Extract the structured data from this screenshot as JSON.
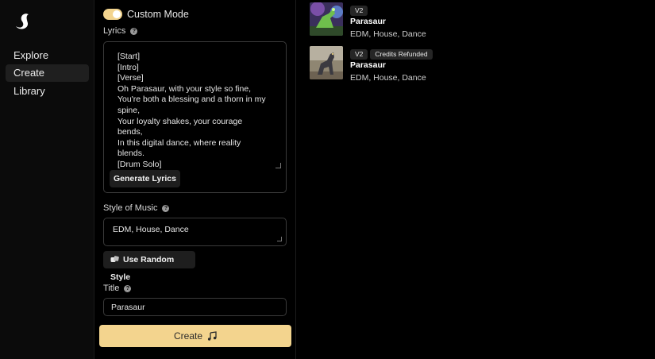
{
  "sidebar": {
    "items": [
      {
        "label": "Explore",
        "active": false
      },
      {
        "label": "Create",
        "active": true
      },
      {
        "label": "Library",
        "active": false
      }
    ]
  },
  "form": {
    "custom_mode_label": "Custom Mode",
    "custom_mode_on": true,
    "lyrics_label": "Lyrics",
    "lyrics_value": "[Start]\n[Intro]\n[Verse]\nOh Parasaur, with your style so fine,\nYou're both a blessing and a thorn in my spine,\nYour loyalty shakes, your courage bends,\nIn this digital dance, where reality blends.\n[Drum Solo]",
    "generate_lyrics_label": "Generate Lyrics",
    "style_label": "Style of Music",
    "style_value": "EDM, House, Dance",
    "random_style_label": "Use Random Style",
    "title_label": "Title",
    "title_value": "Parasaur",
    "create_label": "Create"
  },
  "library": {
    "songs": [
      {
        "badges": [
          "V2"
        ],
        "title": "Parasaur",
        "tags": "EDM, House, Dance"
      },
      {
        "badges": [
          "V2",
          "Credits Refunded"
        ],
        "title": "Parasaur",
        "tags": "EDM, House, Dance"
      }
    ]
  },
  "colors": {
    "accent": "#f3d48e",
    "background": "#000000",
    "sidebar_active": "#1f1f1f",
    "button_dark": "#1e1e1e"
  }
}
